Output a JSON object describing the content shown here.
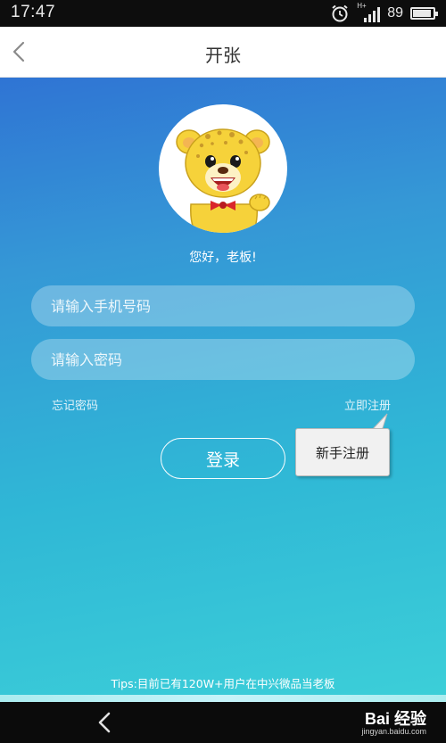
{
  "status_bar": {
    "time": "17:47",
    "network_label": "H+",
    "battery_level": "89",
    "icons": [
      "alarm-icon",
      "signal-icon",
      "battery-icon"
    ]
  },
  "header": {
    "title": "开张",
    "back_icon": "chevron-left-icon"
  },
  "login": {
    "avatar": "leopard-mascot",
    "greeting": "您好，老板!",
    "phone_placeholder": "请输入手机号码",
    "password_placeholder": "请输入密码",
    "forgot_password": "忘记密码",
    "register_now": "立即注册",
    "login_button": "登录",
    "tooltip": "新手注册",
    "tips": "Tips:目前已有120W+用户在中兴微品当老板"
  },
  "nav_bar": {
    "back_icon": "back-arrow-icon",
    "watermark_brand": "Bai 经验",
    "watermark_url": "jingyan.baidu.com"
  },
  "colors": {
    "gradient_top": "#2f74d4",
    "gradient_mid": "#2fb7d6",
    "gradient_bottom": "#3ccfd8",
    "mascot_yellow": "#f6d23a",
    "bow_red": "#d9262b"
  }
}
